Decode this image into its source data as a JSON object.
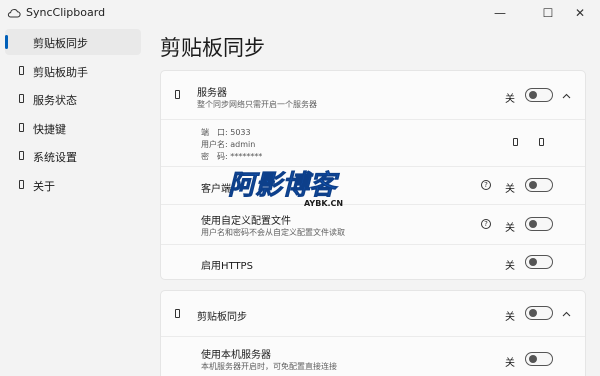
{
  "app": {
    "title": "SyncClipboard",
    "icon": "cloud-sync-icon"
  },
  "window": {
    "minimize": "—",
    "maximize": "☐",
    "close": "✕"
  },
  "sidebar": {
    "items": [
      {
        "label": "剪贴板同步",
        "icon": "clipboard-sync-icon",
        "active": true
      },
      {
        "label": "剪贴板助手",
        "icon": "clipboard-assistant-icon",
        "active": false
      },
      {
        "label": "服务状态",
        "icon": "service-status-icon",
        "active": false
      },
      {
        "label": "快捷键",
        "icon": "hotkey-icon",
        "active": false
      },
      {
        "label": "系统设置",
        "icon": "settings-icon",
        "active": false
      },
      {
        "label": "关于",
        "icon": "about-icon",
        "active": false
      }
    ]
  },
  "page": {
    "title": "剪贴板同步"
  },
  "server_section": {
    "title": "服务器",
    "subtitle": "整个同步网络只需开启一个服务器",
    "state": "关",
    "details": {
      "port": "端　口: 5033",
      "username": "用户名: admin",
      "password": "密　码: ********"
    },
    "client_row": {
      "title": "客户端",
      "state": "关"
    },
    "custom_config": {
      "title": "使用自定义配置文件",
      "subtitle": "用户名和密码不会从自定义配置文件读取",
      "state": "关"
    },
    "https": {
      "title": "启用HTTPS",
      "state": "关"
    }
  },
  "sync_section": {
    "title": "剪贴板同步",
    "state": "关",
    "local_server": {
      "title": "使用本机服务器",
      "subtitle": "本机服务器开启时，可免配置直接连接",
      "state": "关"
    }
  },
  "watermark": {
    "text": "阿影博客",
    "subtext": "AYBK.CN",
    "color": "#1a6fe0"
  },
  "colors": {
    "accent": "#005fb8",
    "background": "#f3f3f3",
    "card": "#fbfbfb"
  }
}
